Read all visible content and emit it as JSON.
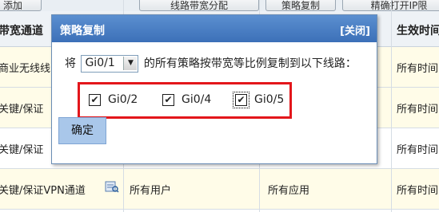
{
  "toolbar": {
    "buttons": [
      "添加",
      "线路带宽分配",
      "策略复制",
      "精确打开IP限"
    ]
  },
  "table": {
    "headers": {
      "channel": "带宽通道",
      "effective_time": "生效时间"
    },
    "rows": [
      {
        "channel": "商业无线线",
        "user": "",
        "app": "",
        "time": "所有时间"
      },
      {
        "channel": "关键/保证",
        "user": "",
        "app": "",
        "time": "所有时间"
      },
      {
        "channel": "关键/保证",
        "user": "",
        "app": "",
        "time": "所有时间"
      },
      {
        "channel": "关键/保证VPN通道",
        "user": "所有用户",
        "app": "所有应用",
        "time": "所有时间"
      }
    ]
  },
  "dialog": {
    "title": "策略复制",
    "close_label": "[关闭]",
    "prefix": "将",
    "source_line": "Gi0/1",
    "suffix": "的所有策略按带宽等比例复制到以下线路：",
    "targets": [
      {
        "label": "Gi0/2",
        "checked": true
      },
      {
        "label": "Gi0/4",
        "checked": true
      },
      {
        "label": "Gi0/5",
        "checked": true
      }
    ],
    "ok_label": "确定"
  },
  "colors": {
    "title_bar": "#3c70b8",
    "highlight_box": "#e3161b",
    "row_yellow": "#fffce8",
    "ok_button": "#a9c7ea"
  }
}
